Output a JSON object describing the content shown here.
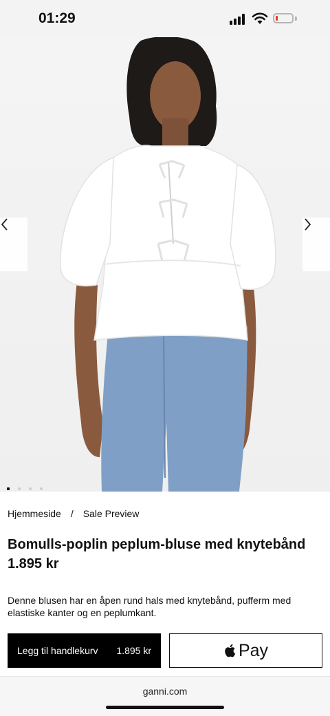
{
  "status_bar": {
    "time": "01:29",
    "battery_level": 0.15,
    "battery_color": "#e5392f"
  },
  "hero": {
    "prev_icon": "chevron-left-icon",
    "next_icon": "chevron-right-icon",
    "image_count": 4,
    "active_index": 0
  },
  "breadcrumb": {
    "home": "Hjemmeside",
    "separator": "/",
    "current": "Sale Preview"
  },
  "product": {
    "title": "Bomulls-poplin peplum-bluse med knytebånd",
    "price": "1.895 kr",
    "description": "Denne blusen har en åpen rund hals med knytebånd, pufferm med elastiske kanter og en peplumkant."
  },
  "actions": {
    "add_to_cart_label": "Legg til handlekurv",
    "add_to_cart_price": "1.895 kr",
    "apple_pay_label": "Pay",
    "apple_pay_icon": "apple-logo-icon"
  },
  "browser": {
    "url": "ganni.com"
  }
}
